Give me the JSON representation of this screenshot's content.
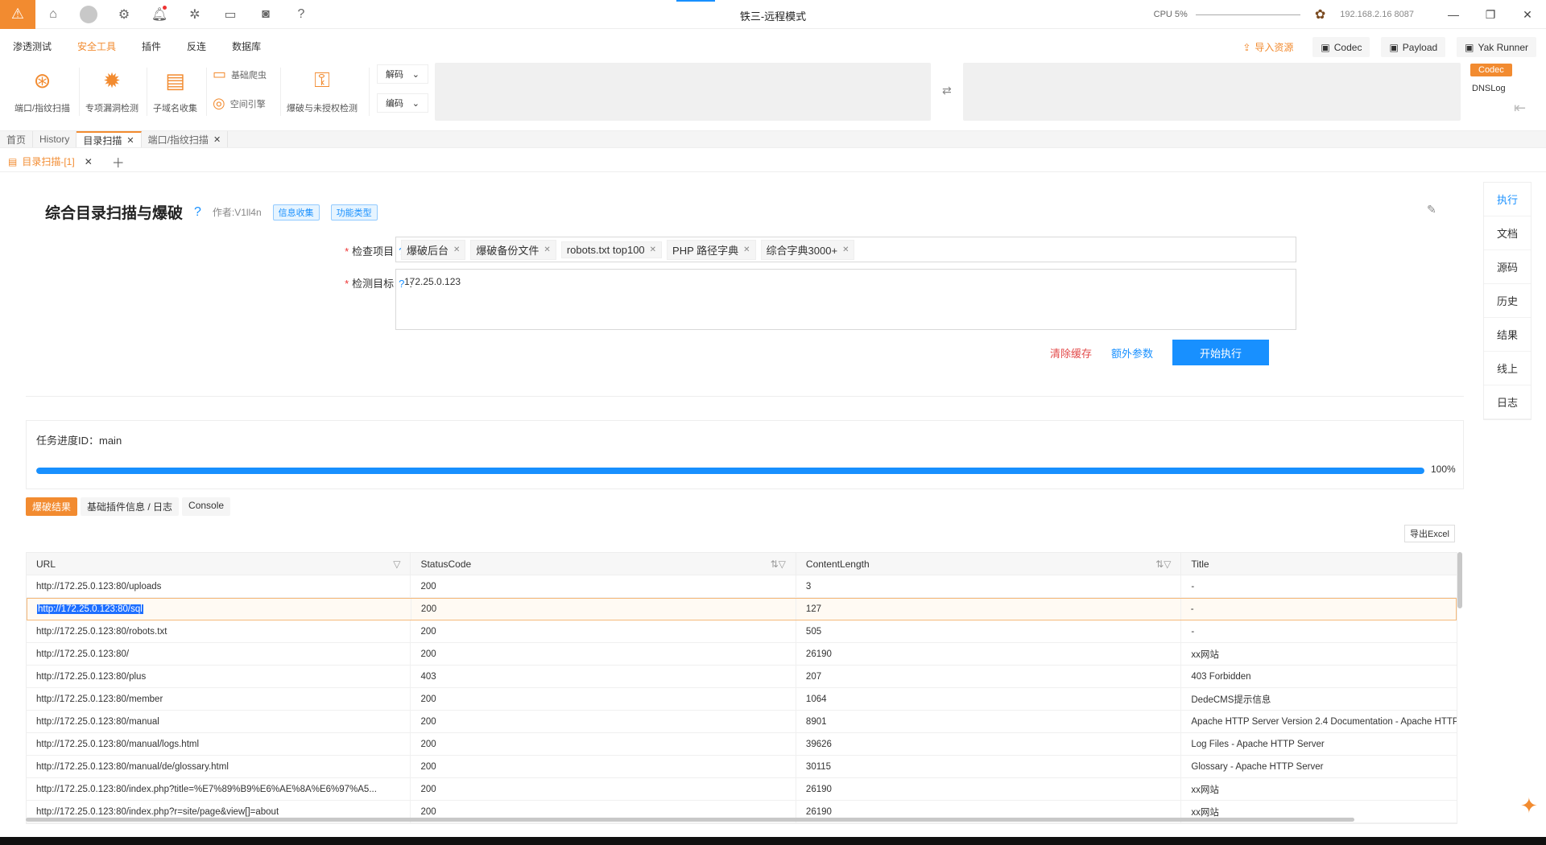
{
  "window": {
    "title": "铁三-远程模式",
    "cpu": "CPU 5%",
    "ip": "192.168.2.16",
    "port": "8087"
  },
  "menu": {
    "items": [
      "渗透测试",
      "安全工具",
      "插件",
      "反连",
      "数据库"
    ],
    "active": "安全工具",
    "import": "导入资源",
    "codec": "Codec",
    "payload": "Payload",
    "yak_runner": "Yak Runner"
  },
  "toolbar": {
    "port_scan": "端口/指纹扫描",
    "vuln_detect": "专项漏洞检测",
    "subdomain": "子域名收集",
    "crawler": "基础爬虫",
    "space_engine": "空间引擎",
    "brute": "爆破与未授权检测",
    "decode": "解码",
    "encode": "编码",
    "codec_tag": "Codec",
    "dnslog": "DNSLog"
  },
  "tabs": {
    "level1": [
      "首页",
      "History",
      "目录扫描",
      "端口/指纹扫描"
    ],
    "level1_active": "目录扫描",
    "level2": "目录扫描-[1]"
  },
  "plugin": {
    "title": "综合目录扫描与爆破",
    "author": "作者:V1ll4n",
    "tags": [
      "信息收集",
      "功能类型"
    ]
  },
  "form": {
    "check_label": "检查项目",
    "target_label": "检测目标",
    "check_items": [
      "爆破后台",
      "爆破备份文件",
      "robots.txt top100",
      "PHP 路径字典",
      "综合字典3000+"
    ],
    "target_value": "172.25.0.123",
    "clear_cache": "清除缓存",
    "extra_params": "额外参数",
    "start": "开始执行"
  },
  "progress": {
    "label": "任务进度ID：main",
    "percent": 100,
    "percent_text": "100%"
  },
  "result_tabs": [
    "爆破结果",
    "基础插件信息 / 日志",
    "Console"
  ],
  "export": "导出Excel",
  "table": {
    "columns": [
      "URL",
      "StatusCode",
      "ContentLength",
      "Title"
    ],
    "rows": [
      [
        "http://172.25.0.123:80/uploads",
        "200",
        "3",
        "-"
      ],
      [
        "http://172.25.0.123:80/sql",
        "200",
        "127",
        "-"
      ],
      [
        "http://172.25.0.123:80/robots.txt",
        "200",
        "505",
        "-"
      ],
      [
        "http://172.25.0.123:80/",
        "200",
        "26190",
        "xx网站"
      ],
      [
        "http://172.25.0.123:80/plus",
        "403",
        "207",
        "403 Forbidden"
      ],
      [
        "http://172.25.0.123:80/member",
        "200",
        "1064",
        "DedeCMS提示信息"
      ],
      [
        "http://172.25.0.123:80/manual",
        "200",
        "8901",
        "Apache HTTP Server Version 2.4 Documentation - Apache HTTP"
      ],
      [
        "http://172.25.0.123:80/manual/logs.html",
        "200",
        "39626",
        "Log Files - Apache HTTP Server"
      ],
      [
        "http://172.25.0.123:80/manual/de/glossary.html",
        "200",
        "30115",
        "Glossary - Apache HTTP Server"
      ],
      [
        "http://172.25.0.123:80/index.php?title=%E7%89%B9%E6%AE%8A%E6%97%A5...",
        "200",
        "26190",
        "xx网站"
      ],
      [
        "http://172.25.0.123:80/index.php?r=site/page&view[]=about",
        "200",
        "26190",
        "xx网站"
      ]
    ],
    "selected_row": 1
  },
  "side_panel": [
    "执行",
    "文档",
    "源码",
    "历史",
    "结果",
    "线上",
    "日志"
  ],
  "colors": {
    "accent": "#f28b30",
    "primary": "#1890ff",
    "danger": "#e34a4a"
  }
}
